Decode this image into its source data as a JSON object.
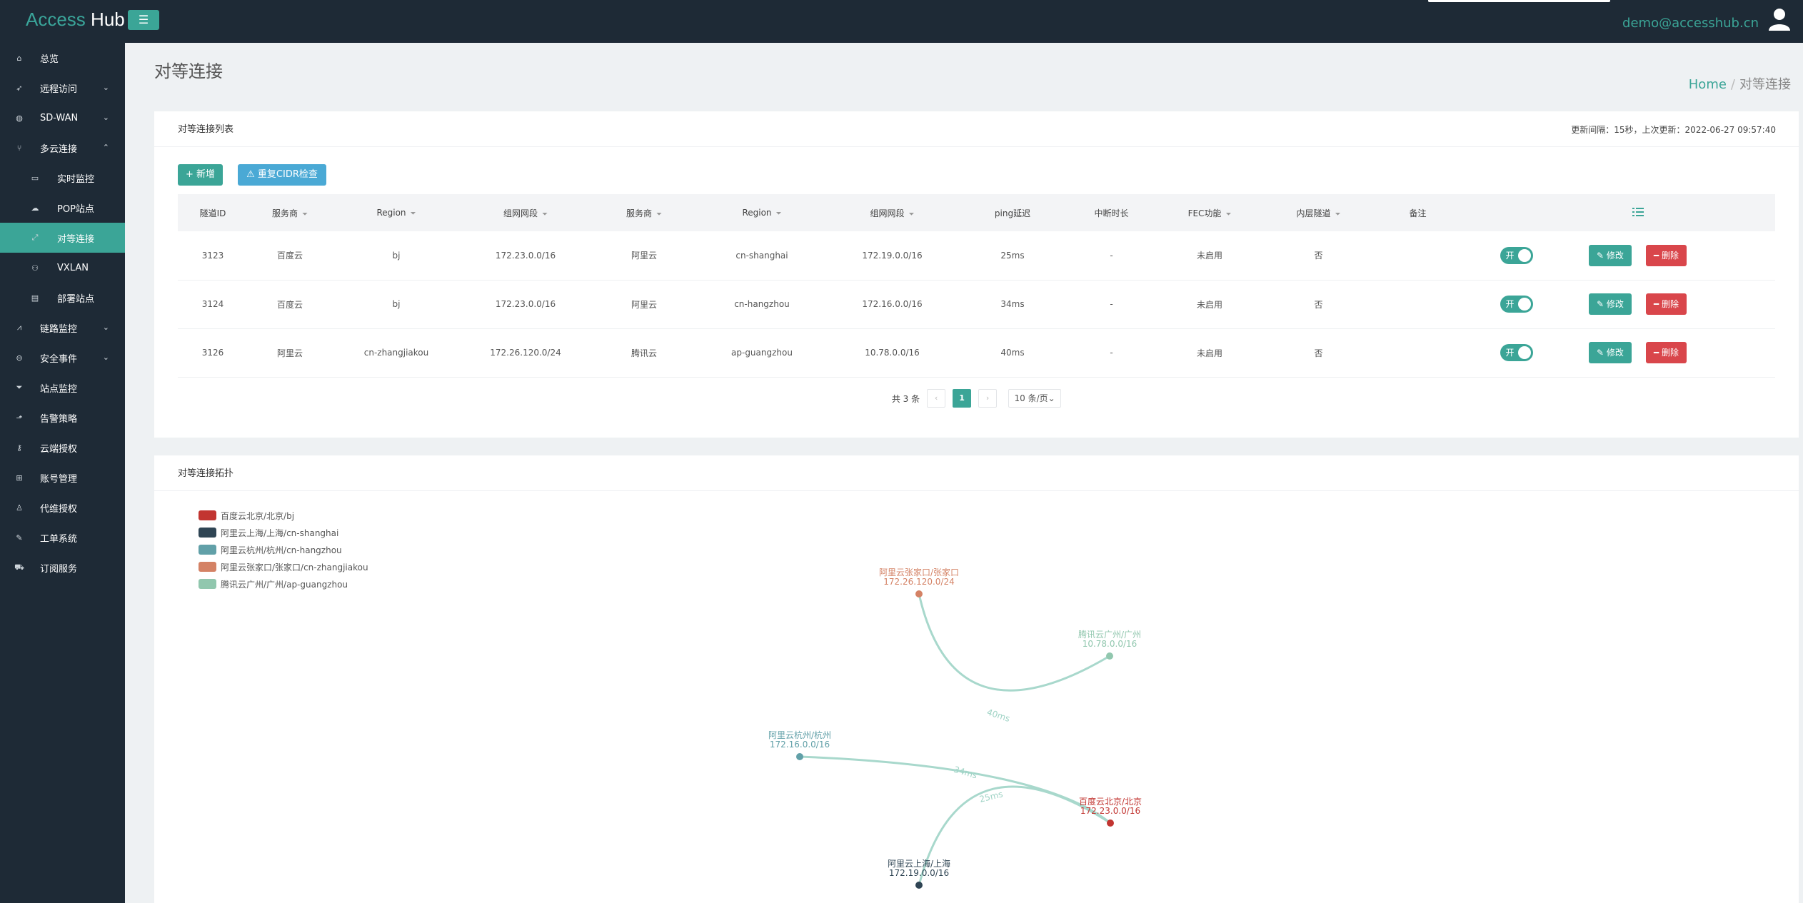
{
  "app": {
    "brand_a": "Access",
    "brand_b": "Hub",
    "menu_toggle": "☰",
    "user_email": "demo@accesshub.cn"
  },
  "sidebar": {
    "items": [
      {
        "label": "总览",
        "icon": "home-icon",
        "glyph": "⌂",
        "chevron": ""
      },
      {
        "label": "远程访问",
        "icon": "rocket-icon",
        "glyph": "➶",
        "chevron": "⌄"
      },
      {
        "label": "SD-WAN",
        "icon": "globe-icon",
        "glyph": "◍",
        "chevron": "⌄"
      },
      {
        "label": "多云连接",
        "icon": "fork-icon",
        "glyph": "⑂",
        "chevron": "⌃"
      },
      {
        "label": "实时监控",
        "icon": "monitor-icon",
        "glyph": "▭",
        "chevron": "",
        "sub": true
      },
      {
        "label": "POP站点",
        "icon": "cloud-icon",
        "glyph": "☁",
        "chevron": "",
        "sub": true
      },
      {
        "label": "对等连接",
        "icon": "expand-icon",
        "glyph": "⤢",
        "chevron": "",
        "sub": true,
        "active": true
      },
      {
        "label": "VXLAN",
        "icon": "network-icon",
        "glyph": "⚇",
        "chevron": "",
        "sub": true
      },
      {
        "label": "部署站点",
        "icon": "server-icon",
        "glyph": "▤",
        "chevron": "",
        "sub": true
      },
      {
        "label": "链路监控",
        "icon": "chart-icon",
        "glyph": "⩘",
        "chevron": "⌄"
      },
      {
        "label": "安全事件",
        "icon": "minus-circle-icon",
        "glyph": "⊖",
        "chevron": "⌄"
      },
      {
        "label": "站点监控",
        "icon": "filter-icon",
        "glyph": "⏷",
        "chevron": ""
      },
      {
        "label": "告警策略",
        "icon": "pointer-icon",
        "glyph": "⬏",
        "chevron": ""
      },
      {
        "label": "云端授权",
        "icon": "key-icon",
        "glyph": "⚷",
        "chevron": ""
      },
      {
        "label": "账号管理",
        "icon": "users-icon",
        "glyph": "⊞",
        "chevron": ""
      },
      {
        "label": "代维授权",
        "icon": "user-icon",
        "glyph": "♙",
        "chevron": ""
      },
      {
        "label": "工单系统",
        "icon": "wrench-icon",
        "glyph": "✎",
        "chevron": ""
      },
      {
        "label": "订阅服务",
        "icon": "cart-icon",
        "glyph": "⛟",
        "chevron": ""
      }
    ]
  },
  "page": {
    "title": "对等连接",
    "breadcrumb_home": "Home",
    "breadcrumb_sep": "/",
    "breadcrumb_current": "对等连接"
  },
  "list": {
    "title": "对等连接列表",
    "refresh_info": "更新间隔：15秒，上次更新：2022-06-27 09:57:40",
    "add_button": "+ 新增",
    "cidr_button": "⚠ 重复CIDR检查",
    "columns": [
      "隧道ID",
      "服务商",
      "Region",
      "组网网段",
      "服务商",
      "Region",
      "组网网段",
      "ping延迟",
      "中断时长",
      "FEC功能",
      "内层隧道",
      "备注"
    ],
    "filter_mark": "⏷",
    "rows": [
      {
        "id": "3123",
        "vendor_a": "百度云",
        "region_a": "bj",
        "cidr_a": "172.23.0.0/16",
        "vendor_b": "阿里云",
        "region_b": "cn-shanghai",
        "cidr_b": "172.19.0.0/16",
        "ping": "25ms",
        "down": "-",
        "fec": "未启用",
        "inner": "否",
        "note": "",
        "toggle": "开",
        "edit": "✎ 修改",
        "del": "━ 删除"
      },
      {
        "id": "3124",
        "vendor_a": "百度云",
        "region_a": "bj",
        "cidr_a": "172.23.0.0/16",
        "vendor_b": "阿里云",
        "region_b": "cn-hangzhou",
        "cidr_b": "172.16.0.0/16",
        "ping": "34ms",
        "down": "-",
        "fec": "未启用",
        "inner": "否",
        "note": "",
        "toggle": "开",
        "edit": "✎ 修改",
        "del": "━ 删除"
      },
      {
        "id": "3126",
        "vendor_a": "阿里云",
        "region_a": "cn-zhangjiakou",
        "cidr_a": "172.26.120.0/24",
        "vendor_b": "腾讯云",
        "region_b": "ap-guangzhou",
        "cidr_b": "10.78.0.0/16",
        "ping": "40ms",
        "down": "-",
        "fec": "未启用",
        "inner": "否",
        "note": "",
        "toggle": "开",
        "edit": "✎ 修改",
        "del": "━ 删除"
      }
    ],
    "pager": {
      "total": "共 3 条",
      "prev": "‹",
      "current": "1",
      "next": "›",
      "page_size": "10 条/页⌄"
    }
  },
  "topology": {
    "title": "对等连接拓扑",
    "legend": [
      {
        "label": "百度云北京/北京/bj",
        "color": "#c23531"
      },
      {
        "label": "阿里云上海/上海/cn-shanghai",
        "color": "#2f4554"
      },
      {
        "label": "阿里云杭州/杭州/cn-hangzhou",
        "color": "#61a0a8"
      },
      {
        "label": "阿里云张家口/张家口/cn-zhangjiakou",
        "color": "#d48265"
      },
      {
        "label": "腾讯云广州/广州/ap-guangzhou",
        "color": "#91c7ae"
      }
    ],
    "nodes": [
      {
        "name": "阿里云张家口/张家口",
        "cidr": "172.26.120.0/24",
        "color": "#d48265"
      },
      {
        "name": "腾讯云广州/广州",
        "cidr": "10.78.0.0/16",
        "color": "#91c7ae"
      },
      {
        "name": "阿里云杭州/杭州",
        "cidr": "172.16.0.0/16",
        "color": "#61a0a8"
      },
      {
        "name": "百度云北京/北京",
        "cidr": "172.23.0.0/16",
        "color": "#c23531"
      },
      {
        "name": "阿里云上海/上海",
        "cidr": "172.19.0.0/16",
        "color": "#2f4554"
      }
    ],
    "links": [
      {
        "label": "40ms"
      },
      {
        "label": "34ms"
      },
      {
        "label": "25ms"
      }
    ],
    "link_color": "#a8d8cc"
  }
}
